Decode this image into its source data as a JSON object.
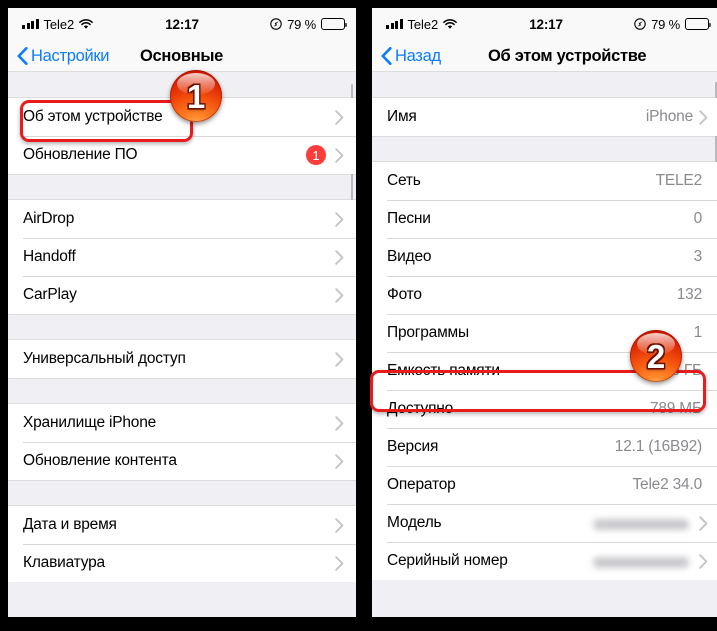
{
  "colors": {
    "accent_blue": "#0a7cff",
    "badge_red": "#fc3d39",
    "highlight_red": "#e81c1c",
    "group_bg": "#efeff4",
    "value_gray": "#8a8a8e"
  },
  "left_phone": {
    "status_bar": {
      "carrier": "Tele2",
      "signal_icon": "signal-bars-icon",
      "wifi_icon": "wifi-icon",
      "time": "12:17",
      "location_icon": "location-arrow-icon",
      "battery_percent": "79 %",
      "battery_icon": "battery-icon"
    },
    "nav": {
      "back_label": "Настройки",
      "back_icon": "chevron-left-icon",
      "title": "Основные"
    },
    "sections": [
      {
        "rows": [
          {
            "label": "Об этом устройстве",
            "value": "",
            "chevron": true,
            "badge": "",
            "highlighted": true
          },
          {
            "label": "Обновление ПО",
            "value": "",
            "chevron": true,
            "badge": "1",
            "highlighted": false
          }
        ]
      },
      {
        "rows": [
          {
            "label": "AirDrop",
            "value": "",
            "chevron": true,
            "badge": "",
            "highlighted": false
          },
          {
            "label": "Handoff",
            "value": "",
            "chevron": true,
            "badge": "",
            "highlighted": false
          },
          {
            "label": "CarPlay",
            "value": "",
            "chevron": true,
            "badge": "",
            "highlighted": false
          }
        ]
      },
      {
        "rows": [
          {
            "label": "Универсальный доступ",
            "value": "",
            "chevron": true,
            "badge": "",
            "highlighted": false
          }
        ]
      },
      {
        "rows": [
          {
            "label": "Хранилище iPhone",
            "value": "",
            "chevron": true,
            "badge": "",
            "highlighted": false
          },
          {
            "label": "Обновление контента",
            "value": "",
            "chevron": true,
            "badge": "",
            "highlighted": false
          }
        ]
      },
      {
        "rows": [
          {
            "label": "Дата и время",
            "value": "",
            "chevron": true,
            "badge": "",
            "highlighted": false
          },
          {
            "label": "Клавиатура",
            "value": "",
            "chevron": true,
            "badge": "",
            "highlighted": false
          }
        ]
      }
    ]
  },
  "right_phone": {
    "status_bar": {
      "carrier": "Tele2",
      "signal_icon": "signal-bars-icon",
      "wifi_icon": "wifi-icon",
      "time": "12:17",
      "location_icon": "location-arrow-icon",
      "battery_percent": "79 %",
      "battery_icon": "battery-icon"
    },
    "nav": {
      "back_label": "Назад",
      "back_icon": "chevron-left-icon",
      "title": "Об этом устройстве"
    },
    "sections": [
      {
        "rows": [
          {
            "label": "Имя",
            "value": "iPhone",
            "chevron": true,
            "blurred": false,
            "highlighted": false
          }
        ]
      },
      {
        "rows": [
          {
            "label": "Сеть",
            "value": "TELE2",
            "chevron": false,
            "blurred": false,
            "highlighted": false
          },
          {
            "label": "Песни",
            "value": "0",
            "chevron": false,
            "blurred": false,
            "highlighted": false
          },
          {
            "label": "Видео",
            "value": "3",
            "chevron": false,
            "blurred": false,
            "highlighted": false
          },
          {
            "label": "Фото",
            "value": "132",
            "chevron": false,
            "blurred": false,
            "highlighted": false
          },
          {
            "label": "Программы",
            "value": "1",
            "chevron": false,
            "blurred": false,
            "highlighted": false
          },
          {
            "label": "Емкость памяти",
            "value": "16 ГБ",
            "chevron": false,
            "blurred": false,
            "highlighted": true
          },
          {
            "label": "Доступно",
            "value": "789 МБ",
            "chevron": false,
            "blurred": false,
            "highlighted": false
          },
          {
            "label": "Версия",
            "value": "12.1 (16B92)",
            "chevron": false,
            "blurred": false,
            "highlighted": false
          },
          {
            "label": "Оператор",
            "value": "Tele2 34.0",
            "chevron": false,
            "blurred": false,
            "highlighted": false
          },
          {
            "label": "Модель",
            "value": "",
            "chevron": true,
            "blurred": true,
            "highlighted": false
          },
          {
            "label": "Серийный номер",
            "value": "",
            "chevron": true,
            "blurred": true,
            "highlighted": false
          }
        ]
      }
    ]
  },
  "annotations": {
    "step_one": "1",
    "step_two": "2"
  }
}
